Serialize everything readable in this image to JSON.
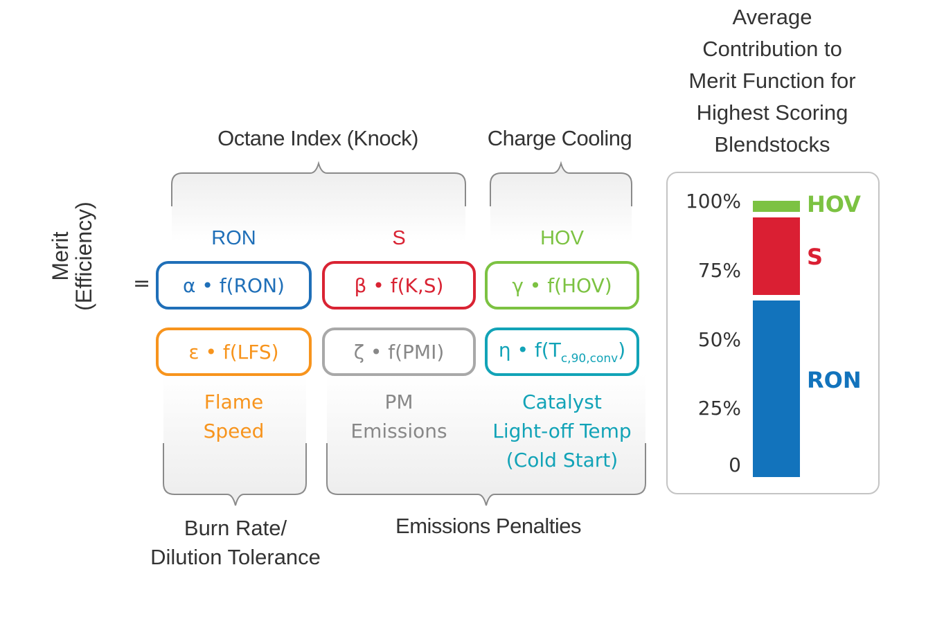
{
  "headings": {
    "octane": "Octane Index (Knock)",
    "charge": "Charge Cooling",
    "burn": [
      "Burn Rate/",
      "Dilution Tolerance"
    ],
    "emissions": "Emissions Penalties"
  },
  "merit_label": [
    "Merit",
    "(Efficiency)"
  ],
  "equals": "=",
  "colors": {
    "ron": "#1f6fb8",
    "s": "#d92333",
    "hov": "#7cc242",
    "lfs": "#f7941d",
    "pmi": "#999999",
    "cat": "#12a3b7"
  },
  "columns": {
    "ron": "RON",
    "s": "S",
    "hov": "HOV"
  },
  "terms": {
    "alpha": "α • f(RON)",
    "beta": "β • f(K,S)",
    "gamma": "γ • f(HOV)",
    "epsilon": "ε • f(LFS)",
    "zeta": "ζ • f(PMI)",
    "eta_main": "η • f(T",
    "eta_sub": "c,90,conv",
    "eta_close": ")"
  },
  "notes": {
    "flame": [
      "Flame",
      "Speed"
    ],
    "pm": [
      "PM",
      "Emissions"
    ],
    "cat": [
      "Catalyst",
      "Light-off Temp",
      "(Cold Start)"
    ]
  },
  "chart_data": {
    "type": "bar",
    "title": "Average Contribution to Merit Function for Highest Scoring Blendstocks",
    "title_lines": [
      "Average",
      "Contribution to",
      "Merit Function for",
      "Highest Scoring",
      "Blendstocks"
    ],
    "stacked": true,
    "ylim": [
      0,
      100
    ],
    "ytick_labels": [
      "0",
      "25%",
      "50%",
      "75%",
      "100%"
    ],
    "yticks": [
      0,
      25,
      50,
      75,
      100
    ],
    "series": [
      {
        "name": "RON",
        "value": 64,
        "color": "#1273bc"
      },
      {
        "name": "S",
        "value": 28,
        "color": "#da1f33"
      },
      {
        "name": "HOV",
        "value": 4,
        "color": "#7cc242"
      }
    ],
    "gap": 2
  }
}
